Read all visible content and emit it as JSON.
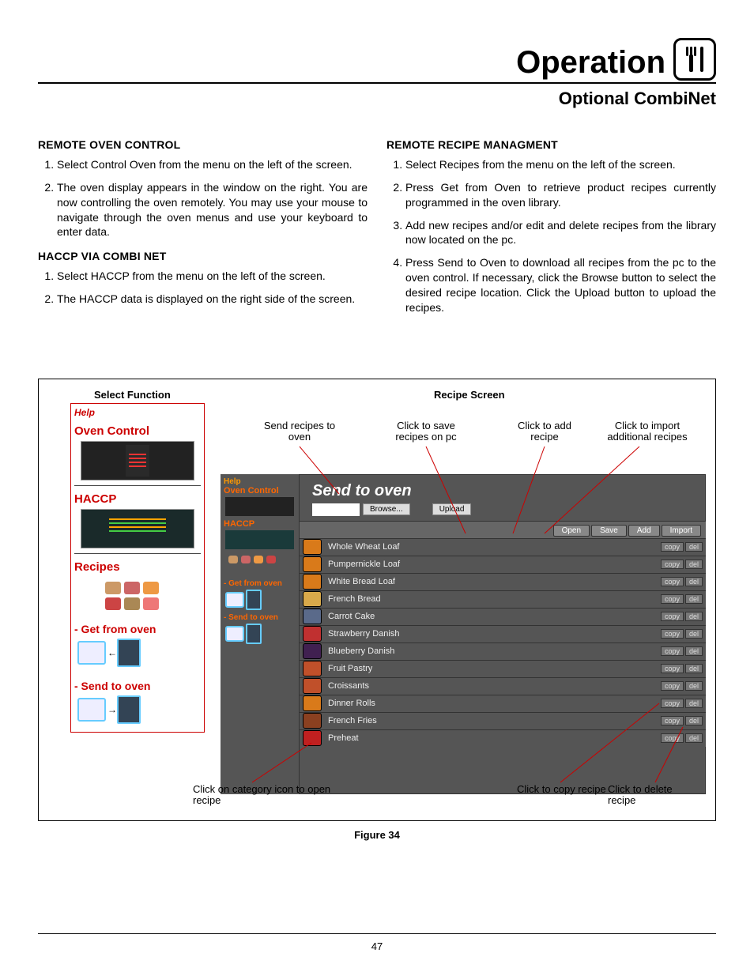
{
  "header": {
    "title": "Operation",
    "subtitle": "Optional CombiNet"
  },
  "left": {
    "h1": "REMOTE OVEN CONTROL",
    "o1_1": "Select Control Oven from the menu on the left of the screen.",
    "o1_2": "The oven display appears in the window on the right. You are now controlling the oven remotely. You may use your mouse to navigate through the oven menus and use your keyboard to enter data.",
    "h2": "HACCP VIA COMBI NET",
    "o2_1": "Select HACCP from the menu on the left of the screen.",
    "o2_2": "The HACCP data is displayed on the right side of the screen."
  },
  "right": {
    "h1": "REMOTE RECIPE MANAGMENT",
    "o1": "Select Recipes from the menu on the left of the screen.",
    "o2": "Press Get from Oven to retrieve product recipes currently programmed in the oven library.",
    "o3": "Add new recipes and/or edit and delete recipes from the library now located on the pc.",
    "o4": "Press Send to Oven to download all recipes from the pc to the oven control. If necessary, click the Browse button to select the desired recipe location. Click the Upload button to upload the recipes."
  },
  "fig": {
    "select_fn": "Select Function",
    "recipe_scr": "Recipe Screen",
    "strip": {
      "help": "Help",
      "oven": "Oven Control",
      "haccp": "HACCP",
      "recipes": "Recipes",
      "get": "- Get from oven",
      "send": "- Send to oven"
    },
    "call": {
      "c1": "Send recipes to oven",
      "c2": "Click to save recipes on pc",
      "c3": "Click to add recipe",
      "c4": "Click to import additional recipes",
      "b1": "Click on category icon to open recipe",
      "b2": "Click to copy recipe",
      "b3": "Click to delete recipe"
    },
    "panel": {
      "side_help": "Help",
      "side_oven": "Oven Control",
      "side_haccp": "HACCP",
      "side_get": "- Get from oven",
      "side_send": "- Send to oven",
      "title": "Send to oven",
      "browse": "Browse...",
      "upload": "Upload",
      "tb_open": "Open",
      "tb_save": "Save",
      "tb_add": "Add",
      "tb_import": "Import",
      "copy": "copy",
      "del": "del",
      "rows": [
        {
          "name": "Whole Wheat Loaf",
          "c": "#d97a1a"
        },
        {
          "name": "Pumpernickle Loaf",
          "c": "#d97a1a"
        },
        {
          "name": "White Bread Loaf",
          "c": "#d97a1a"
        },
        {
          "name": "French Bread",
          "c": "#d9a94a"
        },
        {
          "name": "Carrot Cake",
          "c": "#5a6a8a"
        },
        {
          "name": "Strawberry Danish",
          "c": "#c03030"
        },
        {
          "name": "Blueberry Danish",
          "c": "#402050"
        },
        {
          "name": "Fruit Pastry",
          "c": "#c0502a"
        },
        {
          "name": "Croissants",
          "c": "#c0502a"
        },
        {
          "name": "Dinner Rolls",
          "c": "#d97a1a"
        },
        {
          "name": "French Fries",
          "c": "#8a4020"
        },
        {
          "name": "Preheat",
          "c": "#c02020"
        }
      ]
    }
  },
  "fig_label": "Figure 34",
  "page": "47"
}
